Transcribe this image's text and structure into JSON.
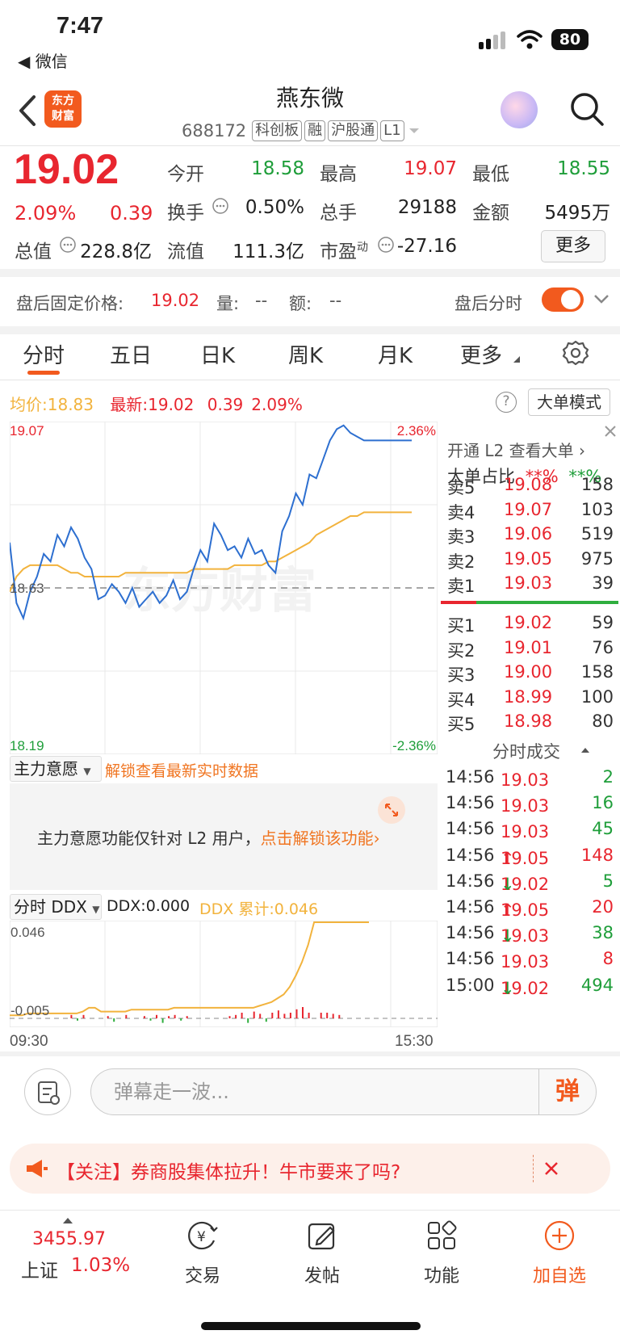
{
  "status_bar": {
    "time": "7:47",
    "back_app": "◀ 微信",
    "battery": "80"
  },
  "header": {
    "logo_text": "东方财富",
    "stock_name": "燕东微",
    "code": "688172",
    "tags": [
      "科创板",
      "融",
      "沪股通",
      "L1"
    ]
  },
  "quote": {
    "price": "19.02",
    "pct": "2.09%",
    "change": "0.39",
    "rows": [
      [
        {
          "label": "今开",
          "value": "18.58",
          "color": "green"
        },
        {
          "label": "最高",
          "value": "19.07",
          "color": "red"
        },
        {
          "label": "最低",
          "value": "18.55",
          "color": "green"
        }
      ],
      [
        {
          "label": "换手",
          "value": "0.50%",
          "color": "dark"
        },
        {
          "label": "总手",
          "value": "29188",
          "color": "dark"
        },
        {
          "label": "金额",
          "value": "5495万",
          "color": "dark"
        }
      ]
    ],
    "total_value_label": "总值",
    "total_value": "228.8亿",
    "float_value_label": "流值",
    "float_value": "111.3亿",
    "pe_label": "市盈",
    "pe_sup": "动",
    "pe_value": "-27.16",
    "more_label": "更多"
  },
  "after_hours": {
    "price_label": "盘后固定价格:",
    "price": "19.02",
    "volume_label": "量:",
    "volume": "--",
    "amount_label": "额:",
    "amount": "--",
    "toggle_label": "盘后分时",
    "toggle_on": true
  },
  "tabs": [
    "分时",
    "五日",
    "日K",
    "周K",
    "月K",
    "更多"
  ],
  "active_tab": "分时",
  "chart_header": {
    "avg_label": "均价:",
    "avg_value": "18.83",
    "latest_label": "最新:",
    "latest_value": "19.02",
    "latest_change": "0.39",
    "latest_pct": "2.09%",
    "big_order_mode": "大单模式"
  },
  "chart_data": {
    "type": "line",
    "y_top": "19.07",
    "y_mid": "18.63",
    "y_bottom": "18.19",
    "pct_top": "2.36%",
    "pct_bottom": "-2.36%",
    "ylim": [
      18.19,
      19.07
    ],
    "x_start": "09:30",
    "x_end": "15:30",
    "watermark": "东方财富",
    "series": [
      {
        "name": "price",
        "color": "#2d6fd0",
        "values": [
          18.75,
          18.59,
          18.55,
          18.62,
          18.66,
          18.72,
          18.7,
          18.77,
          18.74,
          18.79,
          18.76,
          18.71,
          18.68,
          18.6,
          18.61,
          18.64,
          18.62,
          18.59,
          18.63,
          18.58,
          18.6,
          18.62,
          18.59,
          18.61,
          18.65,
          18.6,
          18.62,
          18.68,
          18.73,
          18.7,
          18.8,
          18.77,
          18.73,
          18.74,
          18.71,
          18.76,
          18.72,
          18.73,
          18.69,
          18.67,
          18.78,
          18.82,
          18.88,
          18.85,
          18.93,
          18.92,
          18.97,
          19.02,
          19.05,
          19.06,
          19.04,
          19.03,
          19.02,
          19.02,
          19.02,
          19.02,
          19.02,
          19.02,
          19.02,
          19.02
        ]
      },
      {
        "name": "avg",
        "color": "#f2b33d",
        "values": [
          18.62,
          18.66,
          18.68,
          18.69,
          18.69,
          18.69,
          18.69,
          18.69,
          18.68,
          18.67,
          18.67,
          18.66,
          18.66,
          18.66,
          18.66,
          18.66,
          18.66,
          18.67,
          18.67,
          18.67,
          18.67,
          18.67,
          18.67,
          18.67,
          18.67,
          18.67,
          18.67,
          18.68,
          18.68,
          18.68,
          18.68,
          18.68,
          18.68,
          18.69,
          18.69,
          18.69,
          18.69,
          18.69,
          18.7,
          18.7,
          18.71,
          18.72,
          18.73,
          18.74,
          18.75,
          18.77,
          18.78,
          18.79,
          18.8,
          18.81,
          18.82,
          18.82,
          18.83,
          18.83,
          18.83,
          18.83,
          18.83,
          18.83,
          18.83,
          18.83
        ]
      }
    ]
  },
  "order_book": {
    "promo": "开通 L2 查看大单 ›",
    "ratio_label": "大单占比",
    "ratio_sell": "**%",
    "ratio_buy": "**%",
    "asks": [
      {
        "label": "卖5",
        "price": "19.08",
        "vol": "158"
      },
      {
        "label": "卖4",
        "price": "19.07",
        "vol": "103"
      },
      {
        "label": "卖3",
        "price": "19.06",
        "vol": "519"
      },
      {
        "label": "卖2",
        "price": "19.05",
        "vol": "975"
      },
      {
        "label": "卖1",
        "price": "19.03",
        "vol": "39"
      }
    ],
    "bids": [
      {
        "label": "买1",
        "price": "19.02",
        "vol": "59"
      },
      {
        "label": "买2",
        "price": "19.01",
        "vol": "76"
      },
      {
        "label": "买3",
        "price": "19.00",
        "vol": "158"
      },
      {
        "label": "买4",
        "price": "18.99",
        "vol": "100"
      },
      {
        "label": "买5",
        "price": "18.98",
        "vol": "80"
      }
    ],
    "ticks_title": "分时成交",
    "ticks": [
      {
        "time": "14:56",
        "price": "19.03",
        "arrow": "",
        "vol": "2",
        "vcolor": "green"
      },
      {
        "time": "14:56",
        "price": "19.03",
        "arrow": "",
        "vol": "16",
        "vcolor": "green"
      },
      {
        "time": "14:56",
        "price": "19.03",
        "arrow": "",
        "vol": "45",
        "vcolor": "green"
      },
      {
        "time": "14:56",
        "price": "19.05",
        "arrow": "↑",
        "vol": "148",
        "vcolor": "red"
      },
      {
        "time": "14:56",
        "price": "19.02",
        "arrow": "↓",
        "vol": "5",
        "vcolor": "green"
      },
      {
        "time": "14:56",
        "price": "19.05",
        "arrow": "↑",
        "vol": "20",
        "vcolor": "red"
      },
      {
        "time": "14:56",
        "price": "19.03",
        "arrow": "↓",
        "vol": "38",
        "vcolor": "green"
      },
      {
        "time": "14:56",
        "price": "19.03",
        "arrow": "",
        "vol": "8",
        "vcolor": "red"
      },
      {
        "time": "15:00",
        "price": "19.02",
        "arrow": "↓",
        "vol": "494",
        "vcolor": "green"
      }
    ]
  },
  "main_force": {
    "selector": "主力意愿",
    "unlock_link": "解锁查看最新实时数据",
    "message": "主力意愿功能仅针对 L2 用户，",
    "message_link": "点击解锁该功能›"
  },
  "ddx": {
    "selector": "分时 DDX",
    "ddx_label": "DDX:",
    "ddx_value": "0.000",
    "cum_label": "DDX 累计:",
    "cum_value": "0.046",
    "y_top": "0.046",
    "y_bottom": "-0.005",
    "cum_values": [
      -0.003,
      -0.003,
      -0.003,
      -0.002,
      -0.002,
      -0.002,
      -0.002,
      -0.002,
      -0.002,
      -0.002,
      -0.002,
      -0.002,
      -0.001,
      0.001,
      0.001,
      -0.001,
      -0.001,
      -0.001,
      -0.001,
      -0.001,
      0.0,
      0.0,
      0.0,
      0.0,
      0.0,
      0.0,
      0.0,
      0.001,
      0.001,
      0.001,
      0.001,
      0.001,
      0.001,
      0.001,
      0.001,
      0.001,
      0.001,
      0.001,
      0.001,
      0.001,
      0.001,
      0.002,
      0.003,
      0.004,
      0.006,
      0.008,
      0.012,
      0.018,
      0.025,
      0.034,
      0.046,
      0.046,
      0.046,
      0.046,
      0.046,
      0.046,
      0.046,
      0.046,
      0.046,
      0.046
    ],
    "bars": [
      0,
      0,
      0,
      0,
      0,
      0,
      0,
      0,
      0,
      0,
      0.3,
      -0.2,
      0.3,
      0,
      0,
      0,
      0.2,
      -0.3,
      0,
      0.3,
      0,
      0,
      0.2,
      -0.2,
      0.3,
      -0.4,
      0.2,
      0.3,
      -0.2,
      0.2,
      0,
      0,
      0,
      0,
      0,
      0,
      0.2,
      0.3,
      0.5,
      -0.4,
      0.6,
      0.4,
      -0.3,
      0.5,
      0.7,
      0.4,
      0.5,
      0.8,
      1.0,
      0.5,
      0,
      0.5,
      0.5,
      0.4,
      0.3,
      0,
      0,
      0,
      0,
      0
    ]
  },
  "danmaku": {
    "placeholder": "弹幕走一波...",
    "send_label": "弹"
  },
  "notice": {
    "text": "【关注】券商股集体拉升！牛市要来了吗?"
  },
  "bottom_nav": {
    "index_value": "3455.97",
    "index_name": "上证",
    "index_pct": "1.03%",
    "items": [
      "交易",
      "发帖",
      "功能",
      "加自选"
    ]
  }
}
